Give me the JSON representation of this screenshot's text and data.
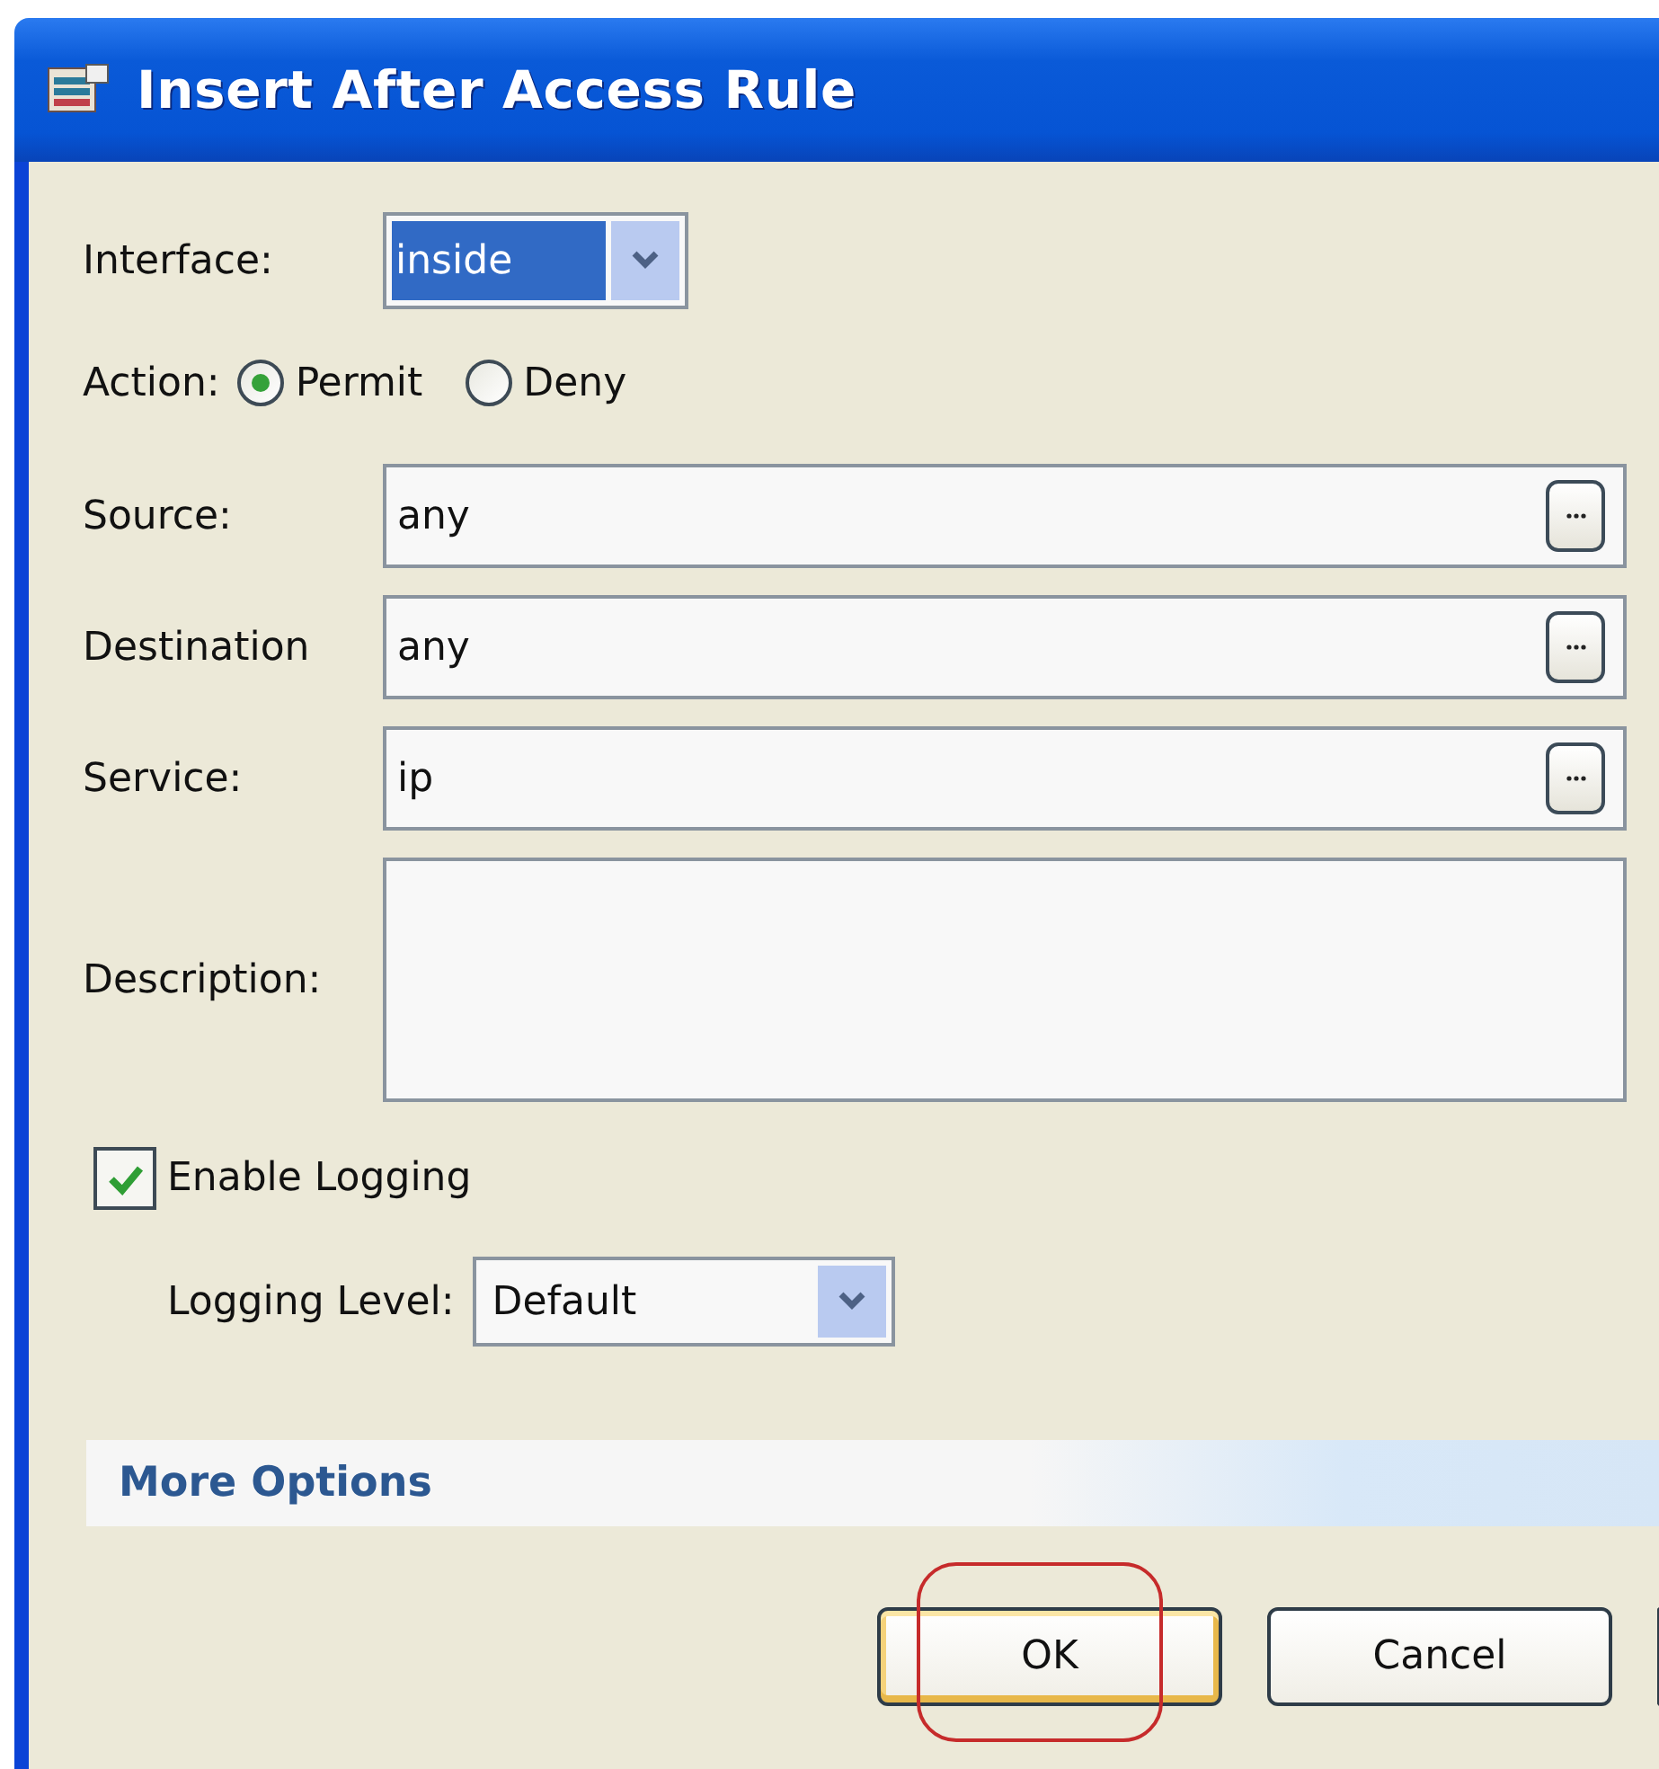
{
  "window": {
    "title": "Insert After Access Rule"
  },
  "interface": {
    "label": "Interface:",
    "value": "inside"
  },
  "action": {
    "label": "Action:",
    "options": [
      {
        "label": "Permit",
        "selected": true
      },
      {
        "label": "Deny",
        "selected": false
      }
    ]
  },
  "fields": [
    {
      "label": "Source:",
      "value": "any"
    },
    {
      "label": "Destination",
      "value": "any"
    },
    {
      "label": "Service:",
      "value": "ip"
    }
  ],
  "description": {
    "label": "Description:"
  },
  "logging": {
    "label": "Enable Logging",
    "checked": true,
    "level_label": "Logging Level:",
    "level_value": "Default"
  },
  "more_options": {
    "label": "More Options"
  },
  "buttons": [
    {
      "label": "OK",
      "default": true,
      "circled": true
    },
    {
      "label": "Cancel",
      "default": false,
      "circled": false
    }
  ]
}
